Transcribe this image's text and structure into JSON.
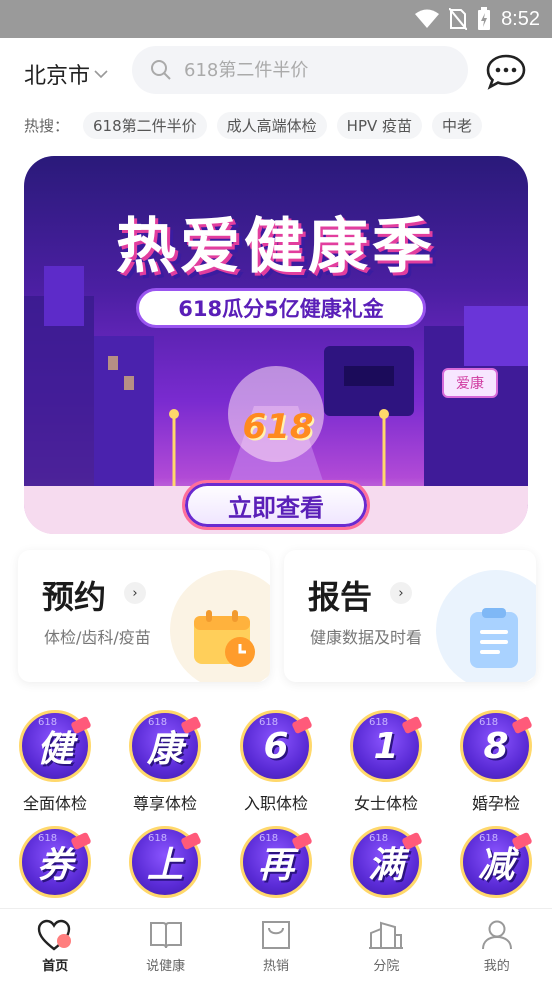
{
  "status_bar": {
    "time": "8:52"
  },
  "header": {
    "city": "北京市",
    "search_placeholder": "618第二件半价"
  },
  "hot_search": {
    "label": "热搜：",
    "tags": [
      "618第二件半价",
      "成人高端体检",
      "HPV 疫苗",
      "中老"
    ]
  },
  "banner": {
    "title": "热爱健康季",
    "subtitle": "618瓜分5亿健康礼金",
    "badge": "618",
    "sign": "爱康",
    "cta": "立即查看"
  },
  "cards": [
    {
      "title": "预约",
      "desc": "体检/齿科/疫苗",
      "arrow": "›"
    },
    {
      "title": "报告",
      "desc": "健康数据及时看",
      "arrow": "›"
    }
  ],
  "grid": [
    {
      "glyph": "健",
      "label": "全面体检"
    },
    {
      "glyph": "康",
      "label": "尊享体检"
    },
    {
      "glyph": "6",
      "label": "入职体检"
    },
    {
      "glyph": "1",
      "label": "女士体检"
    },
    {
      "glyph": "8",
      "label": "婚孕检"
    },
    {
      "glyph": "券",
      "label": ""
    },
    {
      "glyph": "上",
      "label": ""
    },
    {
      "glyph": "再",
      "label": ""
    },
    {
      "glyph": "满",
      "label": ""
    },
    {
      "glyph": "减",
      "label": ""
    }
  ],
  "grid_mini": "618",
  "bottom_nav": [
    {
      "label": "首页",
      "icon": "home-heart-icon",
      "active": true
    },
    {
      "label": "说健康",
      "icon": "book-icon",
      "active": false
    },
    {
      "label": "热销",
      "icon": "shopping-bag-icon",
      "active": false
    },
    {
      "label": "分院",
      "icon": "buildings-icon",
      "active": false
    },
    {
      "label": "我的",
      "icon": "person-icon",
      "active": false
    }
  ],
  "colors": {
    "accent_purple": "#5a2bd6",
    "gold_ring": "#ffd86b",
    "status_bar": "#9a9a9a",
    "nav_active": "#ff6b6b"
  }
}
